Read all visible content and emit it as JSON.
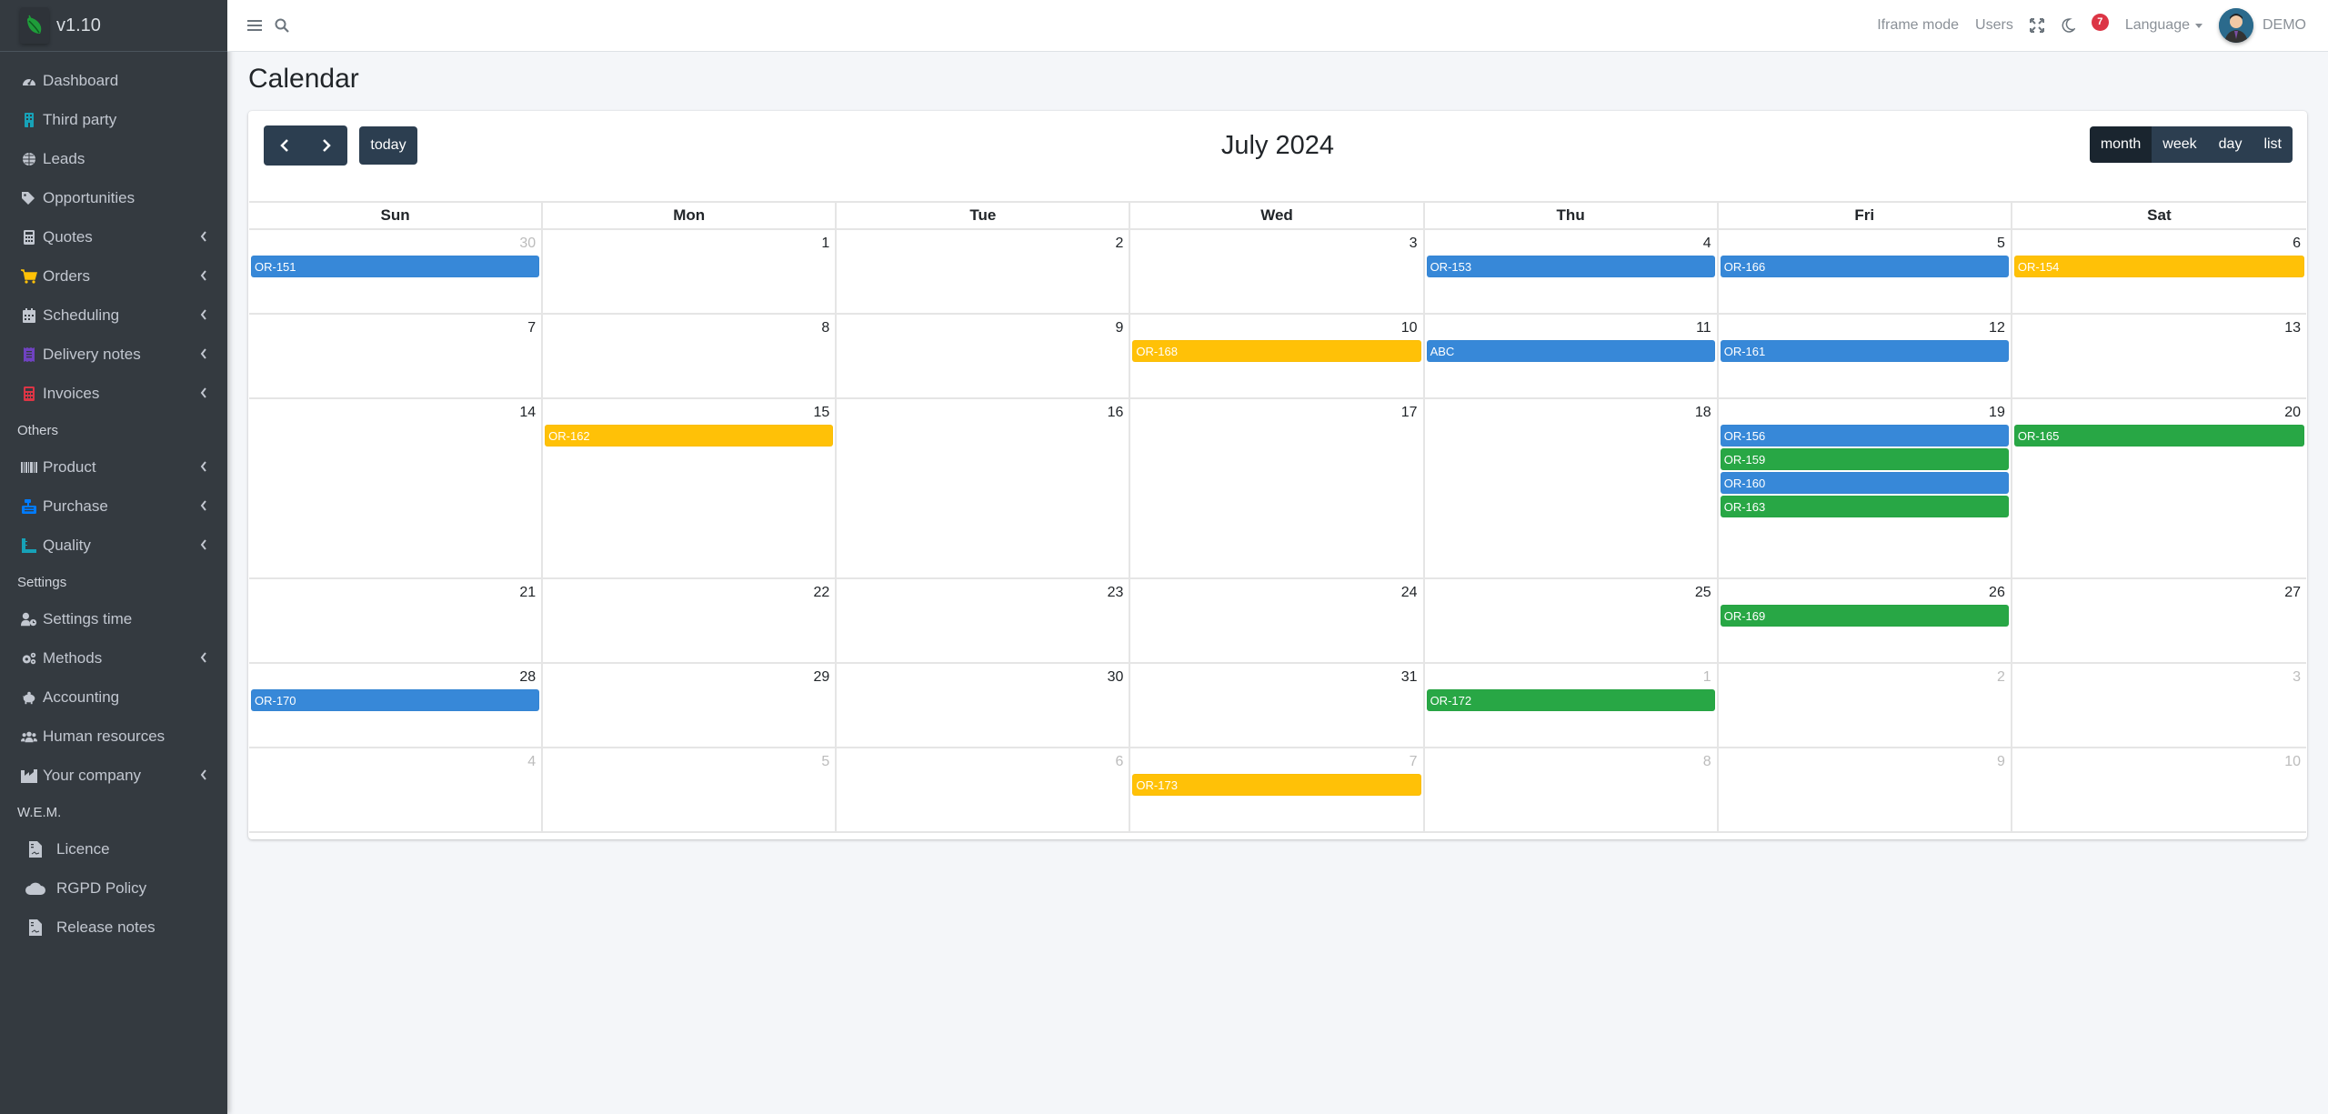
{
  "sidebar": {
    "version": "v1.10",
    "items": [
      {
        "type": "item",
        "label": "Dashboard",
        "icon": "dashboard-icon",
        "color": "#c2c7d0",
        "submenu": false
      },
      {
        "type": "item",
        "label": "Third party",
        "icon": "building-icon",
        "color": "#17a2b8",
        "submenu": false
      },
      {
        "type": "item",
        "label": "Leads",
        "icon": "globe-icon",
        "color": "#c2c7d0",
        "submenu": false
      },
      {
        "type": "item",
        "label": "Opportunities",
        "icon": "tags-icon",
        "color": "#c2c7d0",
        "submenu": false
      },
      {
        "type": "item",
        "label": "Quotes",
        "icon": "calculator-icon",
        "color": "#c2c7d0",
        "submenu": true
      },
      {
        "type": "item",
        "label": "Orders",
        "icon": "cart-icon",
        "color": "#ffc107",
        "submenu": true
      },
      {
        "type": "item",
        "label": "Scheduling",
        "icon": "calendar-icon",
        "color": "#c2c7d0",
        "submenu": true
      },
      {
        "type": "item",
        "label": "Delivery notes",
        "icon": "receipt-icon",
        "color": "#6f42c1",
        "submenu": true
      },
      {
        "type": "item",
        "label": "Invoices",
        "icon": "invoice-icon",
        "color": "#dc3545",
        "submenu": true
      },
      {
        "type": "header",
        "label": "Others"
      },
      {
        "type": "item",
        "label": "Product",
        "icon": "barcode-icon",
        "color": "#c2c7d0",
        "submenu": true
      },
      {
        "type": "item",
        "label": "Purchase",
        "icon": "cash-register-icon",
        "color": "#007bff",
        "submenu": true
      },
      {
        "type": "item",
        "label": "Quality",
        "icon": "ruler-icon",
        "color": "#17a2b8",
        "submenu": true
      },
      {
        "type": "header",
        "label": "Settings"
      },
      {
        "type": "item",
        "label": "Settings time",
        "icon": "user-clock-icon",
        "color": "#c2c7d0",
        "submenu": false
      },
      {
        "type": "item",
        "label": "Methods",
        "icon": "cogs-icon",
        "color": "#c2c7d0",
        "submenu": true
      },
      {
        "type": "item",
        "label": "Accounting",
        "icon": "piggy-bank-icon",
        "color": "#c2c7d0",
        "submenu": false
      },
      {
        "type": "item",
        "label": "Human resources",
        "icon": "users-icon",
        "color": "#c2c7d0",
        "submenu": false
      },
      {
        "type": "item",
        "label": "Your company",
        "icon": "industry-icon",
        "color": "#c2c7d0",
        "submenu": true
      },
      {
        "type": "header",
        "label": "W.E.M."
      },
      {
        "type": "sub",
        "label": "Licence",
        "icon": "file-icon",
        "color": "#c2c7d0",
        "submenu": false
      },
      {
        "type": "sub",
        "label": "RGPD Policy",
        "icon": "cloud-icon",
        "color": "#c2c7d0",
        "submenu": false
      },
      {
        "type": "sub",
        "label": "Release notes",
        "icon": "file-icon",
        "color": "#c2c7d0",
        "submenu": false
      }
    ]
  },
  "topbar": {
    "iframe_mode": "Iframe mode",
    "users": "Users",
    "notification_count": "7",
    "language": "Language",
    "username": "DEMO"
  },
  "page": {
    "title": "Calendar"
  },
  "calendar": {
    "title": "July 2024",
    "today_label": "today",
    "views": [
      {
        "label": "month",
        "active": true
      },
      {
        "label": "week",
        "active": false
      },
      {
        "label": "day",
        "active": false
      },
      {
        "label": "list",
        "active": false
      }
    ],
    "weekdays": [
      "Sun",
      "Mon",
      "Tue",
      "Wed",
      "Thu",
      "Fri",
      "Sat"
    ],
    "event_colors": {
      "blue": "#3788d8",
      "green": "#28a745",
      "yellow": "#ffc107"
    },
    "weeks": [
      [
        {
          "day": "30",
          "other": true,
          "events": [
            {
              "label": "OR-151",
              "color": "blue"
            }
          ]
        },
        {
          "day": "1",
          "other": false,
          "events": []
        },
        {
          "day": "2",
          "other": false,
          "events": []
        },
        {
          "day": "3",
          "other": false,
          "events": []
        },
        {
          "day": "4",
          "other": false,
          "events": [
            {
              "label": "OR-153",
              "color": "blue"
            }
          ]
        },
        {
          "day": "5",
          "other": false,
          "events": [
            {
              "label": "OR-166",
              "color": "blue"
            }
          ]
        },
        {
          "day": "6",
          "other": false,
          "events": [
            {
              "label": "OR-154",
              "color": "yellow"
            }
          ]
        }
      ],
      [
        {
          "day": "7",
          "other": false,
          "events": []
        },
        {
          "day": "8",
          "other": false,
          "events": []
        },
        {
          "day": "9",
          "other": false,
          "events": []
        },
        {
          "day": "10",
          "other": false,
          "events": [
            {
              "label": "OR-168",
              "color": "yellow"
            }
          ]
        },
        {
          "day": "11",
          "other": false,
          "events": [
            {
              "label": "ABC",
              "color": "blue"
            }
          ]
        },
        {
          "day": "12",
          "other": false,
          "events": [
            {
              "label": "OR-161",
              "color": "blue"
            }
          ]
        },
        {
          "day": "13",
          "other": false,
          "events": []
        }
      ],
      [
        {
          "day": "14",
          "other": false,
          "events": []
        },
        {
          "day": "15",
          "other": false,
          "events": [
            {
              "label": "OR-162",
              "color": "yellow"
            }
          ]
        },
        {
          "day": "16",
          "other": false,
          "events": []
        },
        {
          "day": "17",
          "other": false,
          "events": []
        },
        {
          "day": "18",
          "other": false,
          "events": []
        },
        {
          "day": "19",
          "other": false,
          "events": [
            {
              "label": "OR-156",
              "color": "blue"
            },
            {
              "label": "OR-159",
              "color": "green"
            },
            {
              "label": "OR-160",
              "color": "blue"
            },
            {
              "label": "OR-163",
              "color": "green"
            }
          ]
        },
        {
          "day": "20",
          "other": false,
          "events": [
            {
              "label": "OR-165",
              "color": "green"
            }
          ]
        }
      ],
      [
        {
          "day": "21",
          "other": false,
          "events": []
        },
        {
          "day": "22",
          "other": false,
          "events": []
        },
        {
          "day": "23",
          "other": false,
          "events": []
        },
        {
          "day": "24",
          "other": false,
          "events": []
        },
        {
          "day": "25",
          "other": false,
          "events": []
        },
        {
          "day": "26",
          "other": false,
          "events": [
            {
              "label": "OR-169",
              "color": "green"
            }
          ]
        },
        {
          "day": "27",
          "other": false,
          "events": []
        }
      ],
      [
        {
          "day": "28",
          "other": false,
          "events": [
            {
              "label": "OR-170",
              "color": "blue"
            }
          ]
        },
        {
          "day": "29",
          "other": false,
          "events": []
        },
        {
          "day": "30",
          "other": false,
          "events": []
        },
        {
          "day": "31",
          "other": false,
          "events": []
        },
        {
          "day": "1",
          "other": true,
          "events": [
            {
              "label": "OR-172",
              "color": "green"
            }
          ]
        },
        {
          "day": "2",
          "other": true,
          "events": []
        },
        {
          "day": "3",
          "other": true,
          "events": []
        }
      ],
      [
        {
          "day": "4",
          "other": true,
          "events": []
        },
        {
          "day": "5",
          "other": true,
          "events": []
        },
        {
          "day": "6",
          "other": true,
          "events": []
        },
        {
          "day": "7",
          "other": true,
          "events": [
            {
              "label": "OR-173",
              "color": "yellow"
            }
          ]
        },
        {
          "day": "8",
          "other": true,
          "events": []
        },
        {
          "day": "9",
          "other": true,
          "events": []
        },
        {
          "day": "10",
          "other": true,
          "events": []
        }
      ]
    ]
  }
}
